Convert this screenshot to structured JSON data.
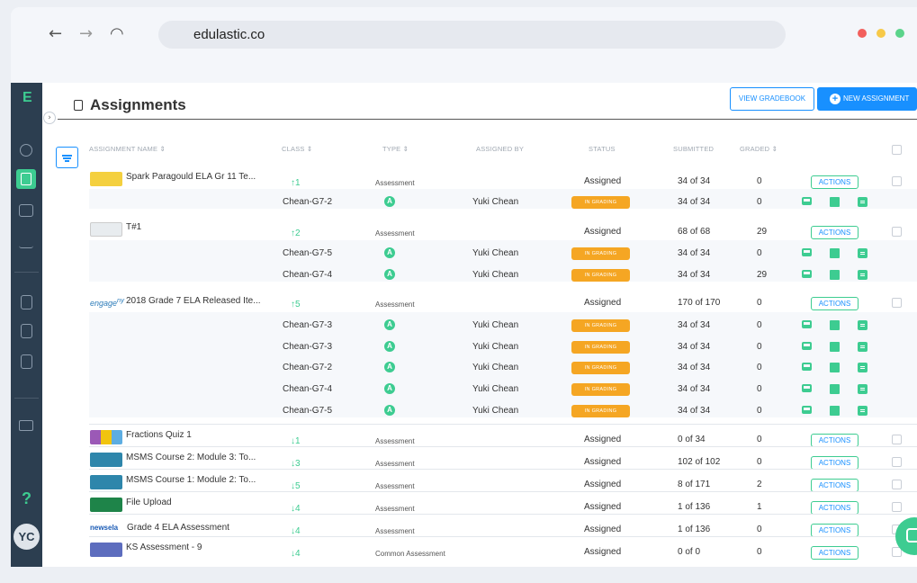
{
  "browser": {
    "url": "edulastic.co",
    "back_icon": "arrow-left-icon",
    "forward_icon": "arrow-right-icon",
    "reload_icon": "reload-icon",
    "dot_colors": [
      "#f25f5c",
      "#f7c948",
      "#5bd48b"
    ]
  },
  "sidebar": {
    "logo": "E",
    "help": "?",
    "avatar": "YC"
  },
  "header": {
    "title": "Assignments",
    "view_gradebook": "VIEW GRADEBOOK",
    "new_assignment": "NEW ASSIGNMENT"
  },
  "table": {
    "headers": {
      "name": "ASSIGNMENT NAME ⇕",
      "class": "CLASS ⇕",
      "type": "TYPE ⇕",
      "assigned_by": "ASSIGNED BY",
      "status": "STATUS",
      "submitted": "SUBMITTED",
      "graded": "GRADED ⇕"
    },
    "actions_label": "ACTIONS",
    "in_grading_label": "IN GRADING",
    "type_badge": "A",
    "rows": [
      {
        "title": "Spark Paragould ELA Gr 11 Te...",
        "class_count": "↑1",
        "type": "Assessment",
        "status": "Assigned",
        "submitted": "34 of 34",
        "graded": "0",
        "subs": [
          {
            "class": "Chean-G7-2",
            "assigned_by": "Yuki Chean",
            "submitted": "34 of 34",
            "graded": "0"
          }
        ]
      },
      {
        "title": "T#1",
        "class_count": "↑2",
        "type": "Assessment",
        "status": "Assigned",
        "submitted": "68 of 68",
        "graded": "29",
        "subs": [
          {
            "class": "Chean-G7-5",
            "assigned_by": "Yuki Chean",
            "submitted": "34 of 34",
            "graded": "0"
          },
          {
            "class": "Chean-G7-4",
            "assigned_by": "Yuki Chean",
            "submitted": "34 of 34",
            "graded": "29"
          }
        ]
      },
      {
        "logo": "engage",
        "logo_sup": "ny",
        "title": "2018 Grade 7 ELA Released Ite...",
        "class_count": "↑5",
        "type": "Assessment",
        "status": "Assigned",
        "submitted": "170 of 170",
        "graded": "0",
        "subs": [
          {
            "class": "Chean-G7-3",
            "assigned_by": "Yuki Chean",
            "submitted": "34 of 34",
            "graded": "0"
          },
          {
            "class": "Chean-G7-3",
            "assigned_by": "Yuki Chean",
            "submitted": "34 of 34",
            "graded": "0"
          },
          {
            "class": "Chean-G7-2",
            "assigned_by": "Yuki Chean",
            "submitted": "34 of 34",
            "graded": "0"
          },
          {
            "class": "Chean-G7-4",
            "assigned_by": "Yuki Chean",
            "submitted": "34 of 34",
            "graded": "0"
          },
          {
            "class": "Chean-G7-5",
            "assigned_by": "Yuki Chean",
            "submitted": "34 of 34",
            "graded": "0"
          }
        ]
      },
      {
        "title": "Fractions Quiz 1",
        "class_count": "↓1",
        "type": "Assessment",
        "status": "Assigned",
        "submitted": "0 of 34",
        "graded": "0"
      },
      {
        "title": "MSMS Course 2: Module 3: To...",
        "class_count": "↓3",
        "type": "Assessment",
        "status": "Assigned",
        "submitted": "102 of 102",
        "graded": "0"
      },
      {
        "title": "MSMS Course 1: Module 2: To...",
        "class_count": "↓5",
        "type": "Assessment",
        "status": "Assigned",
        "submitted": "8 of 171",
        "graded": "2"
      },
      {
        "title": "File Upload",
        "class_count": "↓4",
        "type": "Assessment",
        "status": "Assigned",
        "submitted": "1 of 136",
        "graded": "1"
      },
      {
        "logo": "newsela",
        "title": "Grade 4 ELA Assessment",
        "class_count": "↓4",
        "type": "Assessment",
        "status": "Assigned",
        "submitted": "1 of 136",
        "graded": "0"
      },
      {
        "title": "KS Assessment - 9",
        "class_count": "↓4",
        "type": "Common Assessment",
        "status": "Assigned",
        "submitted": "0 of 0",
        "graded": "0"
      }
    ]
  },
  "colors": {
    "sidebar": "#2c3e50",
    "accent_green": "#3dcc91",
    "primary_blue": "#1890ff",
    "in_grading": "#f5a623"
  }
}
